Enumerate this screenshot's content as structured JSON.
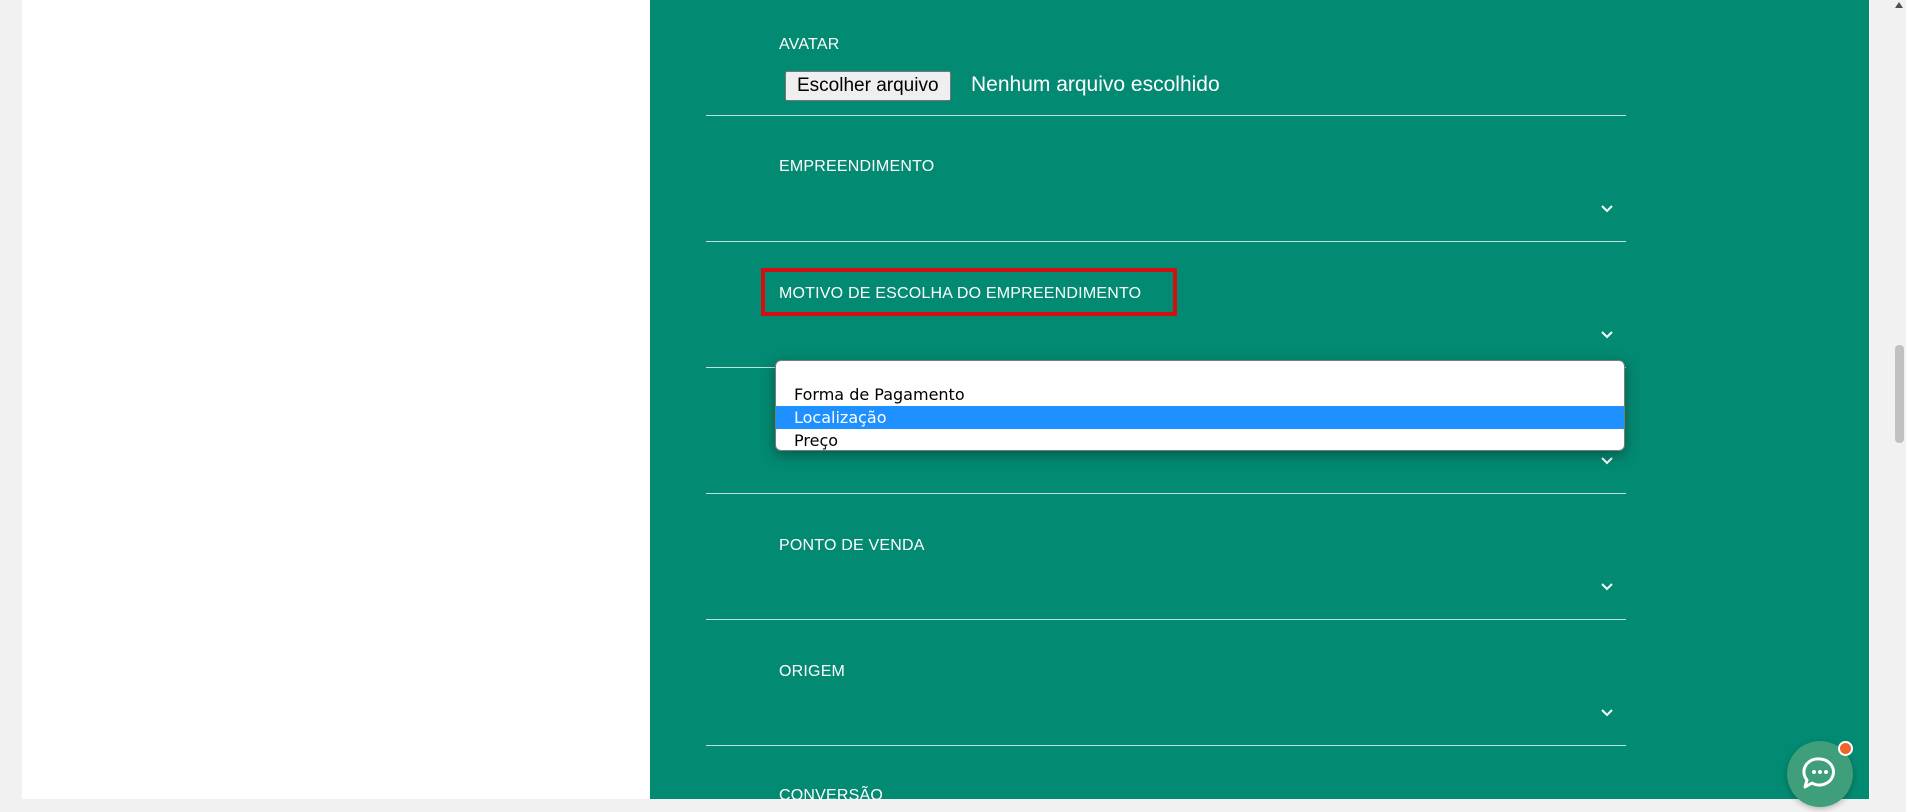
{
  "form": {
    "avatar": {
      "label": "AVATAR",
      "button_label": "Escolher arquivo",
      "status": "Nenhum arquivo escolhido"
    },
    "fields": [
      {
        "label": "EMPREENDIMENTO"
      },
      {
        "label": "MOTIVO DE ESCOLHA DO EMPREENDIMENTO"
      },
      {
        "label": ""
      },
      {
        "label": "PONTO DE VENDA"
      },
      {
        "label": "ORIGEM"
      },
      {
        "label": "CONVERSÃO"
      }
    ]
  },
  "dropdown": {
    "options": [
      "",
      "Forma de Pagamento",
      "Localização",
      "Preço"
    ],
    "selected": "Localização"
  },
  "colors": {
    "panel": "#038a72",
    "highlight": "#d40f0f",
    "selected_option": "#1e90ff",
    "chat_button": "#3f9f7a",
    "notification_dot": "#f0642a"
  },
  "icons": {
    "field_chevron": "chevron-down-icon",
    "chat": "chat-bubble-icon",
    "scroll_up": "scroll-up-arrow-icon"
  }
}
